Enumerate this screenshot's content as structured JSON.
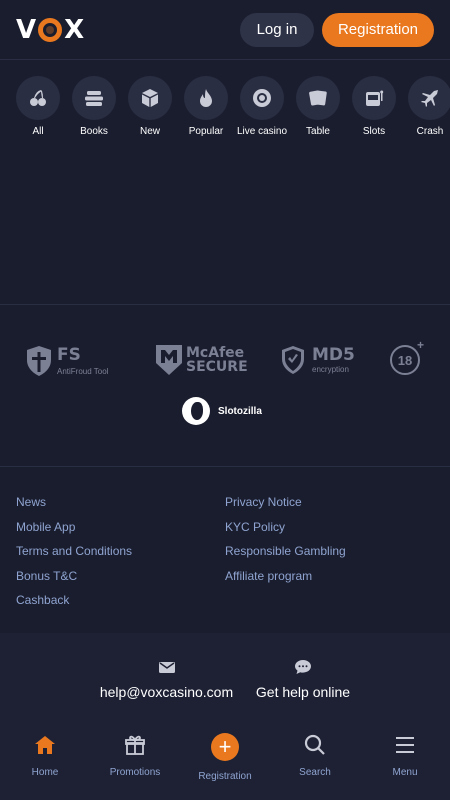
{
  "header": {
    "logo_text_left": "V",
    "logo_text_right": "X",
    "login_label": "Log in",
    "register_label": "Registration",
    "accent_color": "#e9781f"
  },
  "categories": [
    {
      "label": "All",
      "icon": "cherries-icon"
    },
    {
      "label": "Books",
      "icon": "books-icon"
    },
    {
      "label": "New",
      "icon": "cube-icon"
    },
    {
      "label": "Popular",
      "icon": "flame-icon"
    },
    {
      "label": "Live casino",
      "icon": "chip-icon"
    },
    {
      "label": "Table",
      "icon": "cards-icon"
    },
    {
      "label": "Slots",
      "icon": "slot-machine-icon"
    },
    {
      "label": "Crash",
      "icon": "plane-icon"
    }
  ],
  "badges": {
    "fs_title": "FS",
    "fs_sub": "AntiFroud Tool",
    "mcafee_line1": "McAfee",
    "mcafee_line2": "SECURE",
    "md5_title": "MD5",
    "md5_sub": "encryption",
    "age": "18",
    "slotozilla": "Slotozilla"
  },
  "footer_links": {
    "left": [
      "News",
      "Mobile App",
      "Terms and Conditions",
      "Bonus T&C",
      "Cashback"
    ],
    "right": [
      "Privacy Notice",
      "KYC Policy",
      "Responsible Gambling",
      "Affiliate program"
    ]
  },
  "contact": {
    "email": "help@voxcasino.com",
    "help": "Get help online"
  },
  "bottom_nav": [
    {
      "label": "Home",
      "icon": "home-icon"
    },
    {
      "label": "Promotions",
      "icon": "gift-icon"
    },
    {
      "label": "Registration",
      "icon": "plus-icon"
    },
    {
      "label": "Search",
      "icon": "search-icon"
    },
    {
      "label": "Menu",
      "icon": "menu-icon"
    }
  ]
}
